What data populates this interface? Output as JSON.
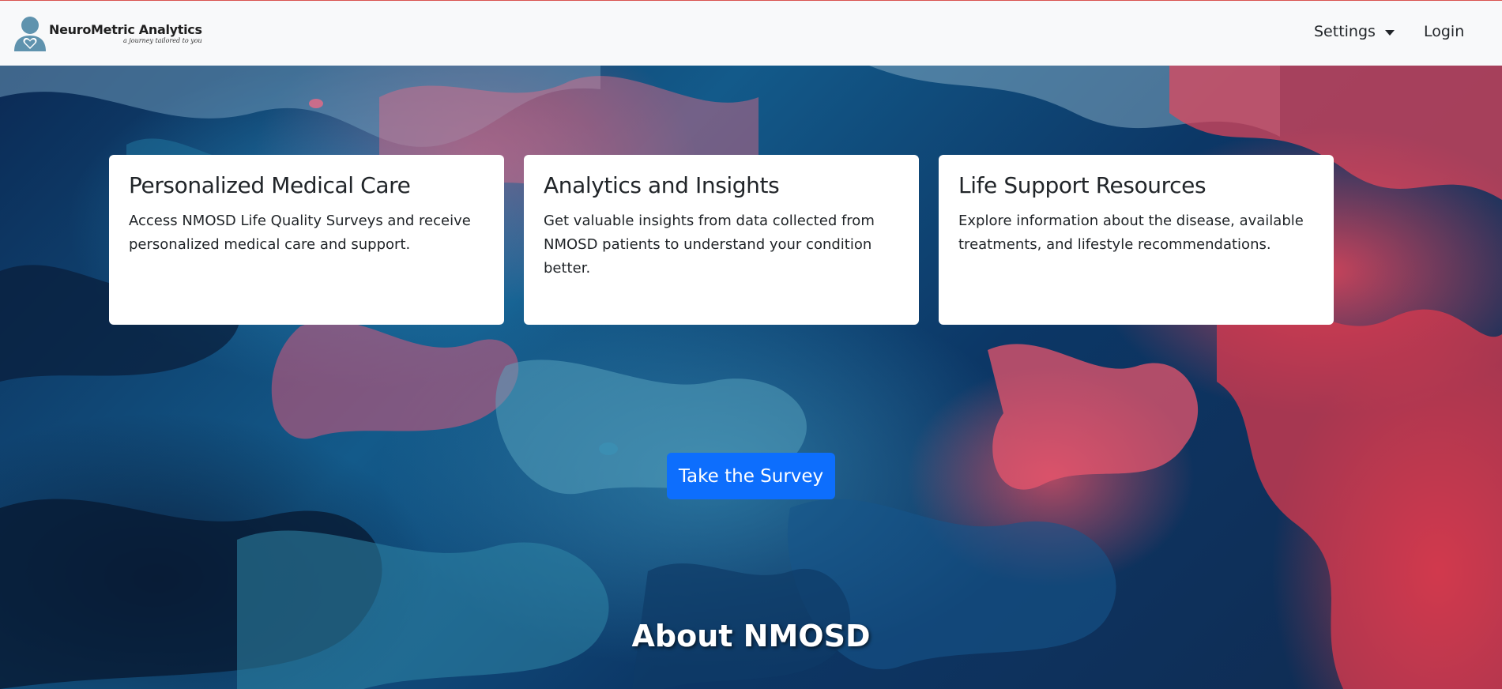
{
  "navbar": {
    "brand_name": "NeuroMetric Analytics",
    "brand_tagline": "a journey tailored to you",
    "settings_label": "Settings",
    "login_label": "Login"
  },
  "features": [
    {
      "title": "Personalized Medical Care",
      "text": "Access NMOSD Life Quality Surveys and receive personalized medical care and support."
    },
    {
      "title": "Analytics and Insights",
      "text": "Get valuable insights from data collected from NMOSD patients to understand your condition better."
    },
    {
      "title": "Life Support Resources",
      "text": "Explore information about the disease, available treatments, and lifestyle recommendations."
    }
  ],
  "cta": {
    "survey_label": "Take the Survey"
  },
  "about": {
    "heading": "About NMOSD"
  },
  "colors": {
    "primary": "#0d6efd",
    "navbar_bg": "#f8f9fa",
    "brand_icon": "#5f93ae",
    "hero_red": "#e8465a",
    "hero_blue": "#135a8a"
  },
  "icons": {
    "brand": "person-heart-icon",
    "settings_caret": "caret-down-icon"
  }
}
